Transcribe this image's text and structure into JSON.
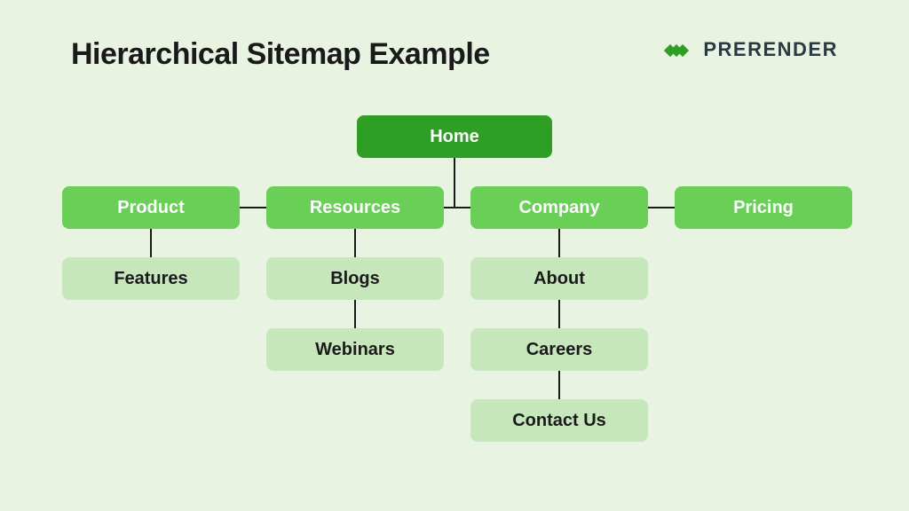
{
  "title": "Hierarchical Sitemap Example",
  "brand": {
    "name": "PRERENDER"
  },
  "root": {
    "label": "Home"
  },
  "categories": {
    "product": {
      "label": "Product",
      "children": [
        "Features"
      ]
    },
    "resources": {
      "label": "Resources",
      "children": [
        "Blogs",
        "Webinars"
      ]
    },
    "company": {
      "label": "Company",
      "children": [
        "About",
        "Careers",
        "Contact Us"
      ]
    },
    "pricing": {
      "label": "Pricing",
      "children": []
    }
  },
  "colors": {
    "root_bg": "#2f9e24",
    "cat_bg": "#69cf57",
    "leaf_bg": "#c6e7bb",
    "page_bg": "#e8f3e2",
    "line": "#1a1a1a",
    "brand_accent": "#2f9e24"
  }
}
